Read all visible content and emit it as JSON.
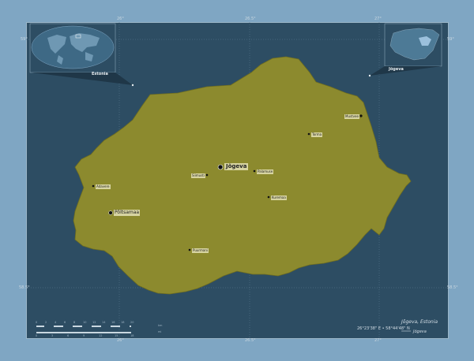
{
  "map": {
    "region_name": "Jõgeva, Estonia",
    "country": "Estonia",
    "region_short": "Jõgeva",
    "coords": "26°23'38\" E  •  58°44'48\" N",
    "legend_label": "Jõgeva",
    "attribution_1": "",
    "attribution_2": "",
    "colors": {
      "background": "#7fa6c3",
      "frame": "#2d4d63",
      "region_fill": "#8c8a2e",
      "region_stroke": "#6f6d1f",
      "grid": "#5f7f95",
      "inset_land": "#4d7a96",
      "inset_highlight": "#9bc0dc"
    },
    "lat_ticks": [
      "59°",
      "58.5°"
    ],
    "lon_ticks": [
      "26°",
      "26.5°",
      "27°"
    ],
    "scale_top": [
      "0",
      "2",
      "4",
      "6",
      "8",
      "10",
      "12",
      "14",
      "16",
      "18",
      "20"
    ],
    "scale_bottom": [
      "0",
      "3",
      "6",
      "9",
      "12",
      "15",
      "18"
    ],
    "scale_units": [
      "km",
      "mi"
    ],
    "cities": [
      {
        "name": "Jõgeva",
        "tier": "big"
      },
      {
        "name": "Põltsamaa",
        "tier": "mid"
      },
      {
        "name": "Mustvee",
        "tier": "small"
      },
      {
        "name": "Torma",
        "tier": "small"
      },
      {
        "name": "Palamuse",
        "tier": "small"
      },
      {
        "name": "Siimusti",
        "tier": "small"
      },
      {
        "name": "Kuremaa",
        "tier": "small"
      },
      {
        "name": "Adavere",
        "tier": "small"
      },
      {
        "name": "Puurmani",
        "tier": "small"
      }
    ]
  }
}
